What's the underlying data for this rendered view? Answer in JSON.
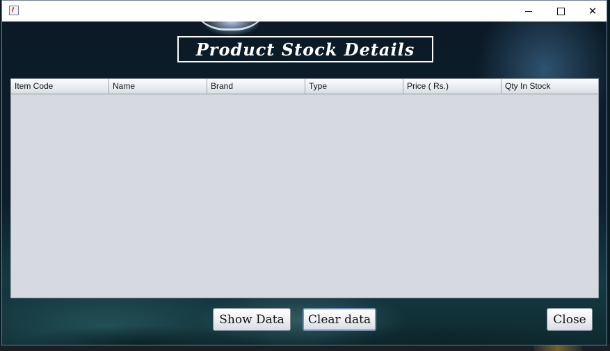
{
  "window": {
    "title": "",
    "controls": {
      "minimize": "minimize",
      "maximize": "maximize",
      "close": "close"
    }
  },
  "form": {
    "title": "Product Stock Details"
  },
  "table": {
    "columns": [
      "Item Code",
      "Name",
      "Brand",
      "Type",
      "Price ( Rs.)",
      "Qty In Stock"
    ],
    "rows": []
  },
  "buttons": {
    "show_data": "Show Data",
    "clear_data": "Clear data",
    "close": "Close"
  },
  "colors": {
    "table_background": "#d6d9e0",
    "title_text": "#ffffff"
  }
}
